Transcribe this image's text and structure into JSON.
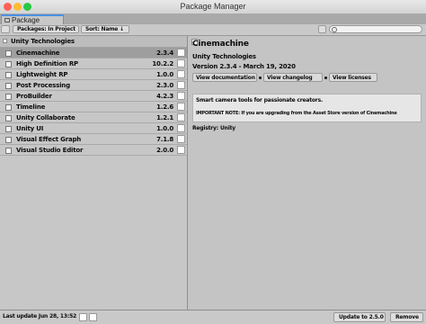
{
  "window": {
    "title": "Package Manager"
  },
  "colors": {
    "close": "#ff5f57",
    "minimize": "#febc2e",
    "maximize": "#28c840",
    "tab_accent": "#4a90e2"
  },
  "tab": {
    "label": "Package Manager",
    "icon": "package-icon"
  },
  "toolbar": {
    "packages_dropdown": "Packages: In Project",
    "sort_dropdown": "Sort: Name ↓",
    "search_placeholder": ""
  },
  "package_list": {
    "group_label": "Unity Technologies",
    "items": [
      {
        "name": "Cinemachine",
        "version": "2.3.4",
        "selected": true
      },
      {
        "name": "High Definition RP",
        "version": "10.2.2",
        "selected": false
      },
      {
        "name": "Lightweight RP",
        "version": "1.0.0",
        "selected": false
      },
      {
        "name": "Post Processing",
        "version": "2.3.0",
        "selected": false
      },
      {
        "name": "ProBuilder",
        "version": "4.2.3",
        "selected": false
      },
      {
        "name": "Timeline",
        "version": "1.2.6",
        "selected": false
      },
      {
        "name": "Unity Collaborate",
        "version": "1.2.1",
        "selected": false
      },
      {
        "name": "Unity UI",
        "version": "1.0.0",
        "selected": false
      },
      {
        "name": "Visual Effect Graph",
        "version": "7.1.8",
        "selected": false
      },
      {
        "name": "Visual Studio Editor",
        "version": "2.0.0",
        "selected": false
      }
    ]
  },
  "details": {
    "title": "Cinemachine",
    "author": "Unity Technologies",
    "version_line": "Version 2.3.4 - March 19, 2020",
    "links": [
      "View documentation",
      "View changelog",
      "View licenses"
    ],
    "description": "Smart camera tools for passionate creators.",
    "note": "IMPORTANT NOTE: If you are upgrading from the Asset Store version of Cinemachine",
    "registry_label": "Registry:",
    "registry_value": "Unity"
  },
  "statusbar": {
    "last_update": "Last update Jun 28, 13:52",
    "update_button": "Update to 2.5.0",
    "remove_button": "Remove"
  }
}
